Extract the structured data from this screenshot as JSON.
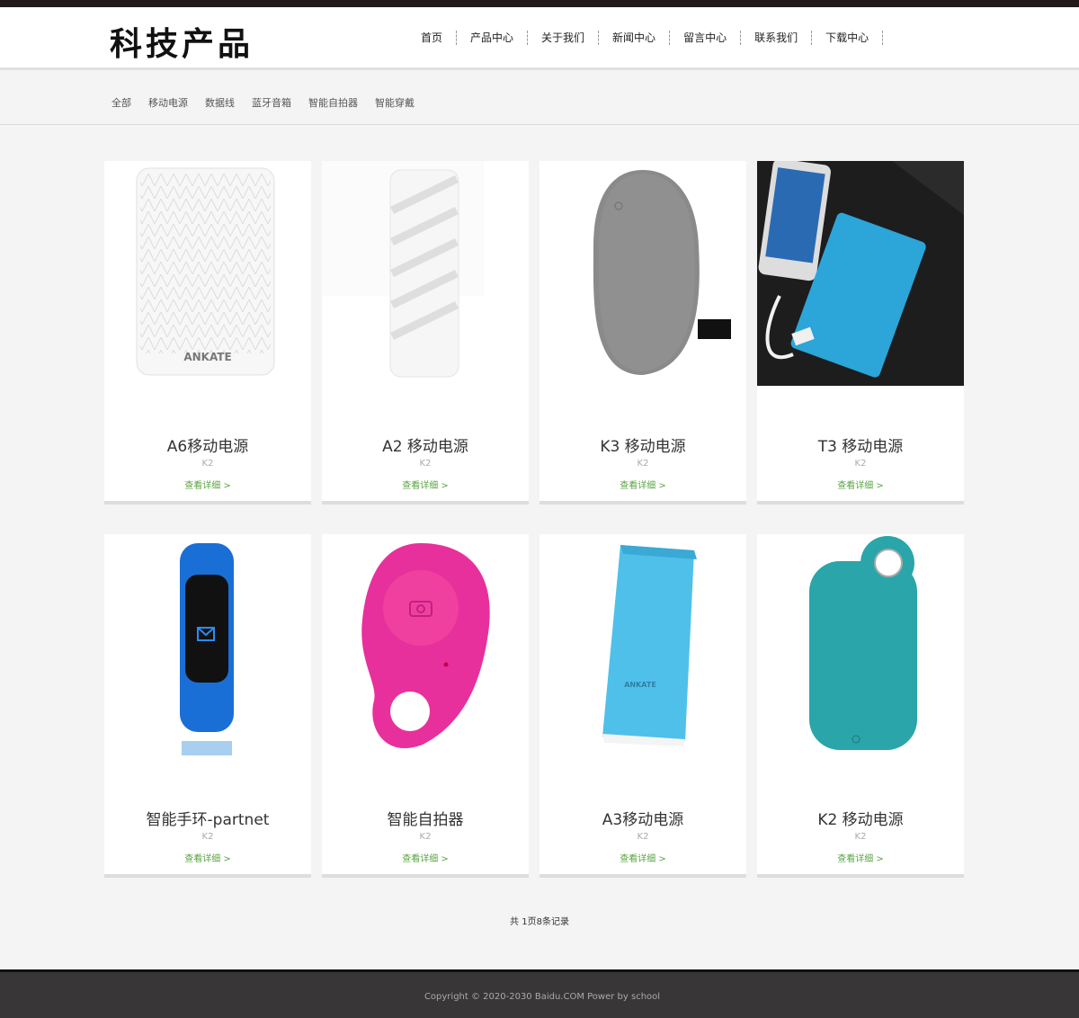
{
  "header": {
    "logo": "科技产品",
    "nav": [
      "首页",
      "产品中心",
      "关于我们",
      "新闻中心",
      "留言中心",
      "联系我们",
      "下载中心"
    ]
  },
  "filters": [
    "全部",
    "移动电源",
    "数据线",
    "蓝牙音箱",
    "智能自拍器",
    "智能穿戴"
  ],
  "products": [
    {
      "title": "A6移动电源",
      "sub": "K2",
      "link": "查看详细 >"
    },
    {
      "title": "A2 移动电源",
      "sub": "K2",
      "link": "查看详细 >"
    },
    {
      "title": "K3 移动电源",
      "sub": "K2",
      "link": "查看详细 >"
    },
    {
      "title": "T3 移动电源",
      "sub": "K2",
      "link": "查看详细 >"
    },
    {
      "title": "智能手环-partnet",
      "sub": "K2",
      "link": "查看详细 >"
    },
    {
      "title": "智能自拍器",
      "sub": "K2",
      "link": "查看详细 >"
    },
    {
      "title": "A3移动电源",
      "sub": "K2",
      "link": "查看详细 >"
    },
    {
      "title": "K2 移动电源",
      "sub": "K2",
      "link": "查看详细 >"
    }
  ],
  "product_images": {
    "p1_brand": "ANKATE",
    "p7_brand": "ANKATE"
  },
  "pager": "共 1页8条记录",
  "footer": {
    "copyright": "Copyright © 2020-2030 Baidu.COM Power by school"
  },
  "colors": {
    "accent_link": "#5aa341",
    "footer_bg": "#383636",
    "topbar": "#231a1a"
  }
}
